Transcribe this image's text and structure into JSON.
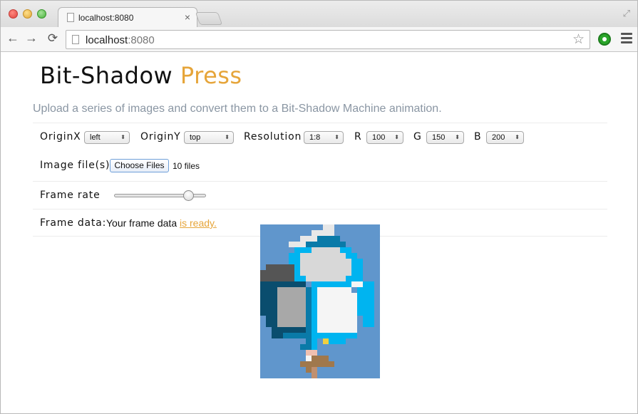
{
  "browser": {
    "tab_title": "localhost:8080",
    "tab_close": "×",
    "url_host": "localhost",
    "url_port": ":8080",
    "back_glyph": "←",
    "forward_glyph": "→",
    "reload_glyph": "⟳",
    "star_glyph": "☆",
    "resize_glyph": "⤢",
    "icons": [
      "back-icon",
      "forward-icon",
      "reload-icon",
      "page-icon",
      "bookmark-star-icon",
      "extension-icon",
      "menu-icon",
      "fullscreen-icon"
    ]
  },
  "header": {
    "brand_primary": "Bit-Shadow",
    "brand_accent": "Press",
    "subtitle": "Upload a series of images and convert them to a Bit-Shadow Machine animation."
  },
  "controls": {
    "originx_label": "OriginX",
    "originx_value": "left",
    "originy_label": "OriginY",
    "originy_value": "top",
    "resolution_label": "Resolution",
    "resolution_value": "1:8",
    "r_label": "R",
    "r_value": "100",
    "g_label": "G",
    "g_value": "150",
    "b_label": "B",
    "b_value": "200",
    "select_arrow": "⬍"
  },
  "image_files": {
    "label": "Image file(s)",
    "button_label": "Choose Files",
    "status": "10 files"
  },
  "frame_rate": {
    "label": "Frame rate",
    "value_fraction": 0.85
  },
  "frame_data": {
    "label": "Frame data:",
    "text": "Your frame data",
    "link": "is ready."
  },
  "preview": {
    "description_colors": {
      "background": "#6096cc",
      "cyan": "#00b4f0",
      "teal": "#0a7aa8",
      "dark": "#0a4d6e",
      "light_gray": "#d8d8d8",
      "gray": "#a8a8a8",
      "dark_gray": "#555555",
      "white": "#f5f5f5",
      "brown": "#a0784c",
      "pink": "#f0c0b0",
      "yellow": "#f0d040"
    }
  },
  "colors": {
    "accent": "#e6a53a",
    "subtitle": "#8a96a3"
  }
}
